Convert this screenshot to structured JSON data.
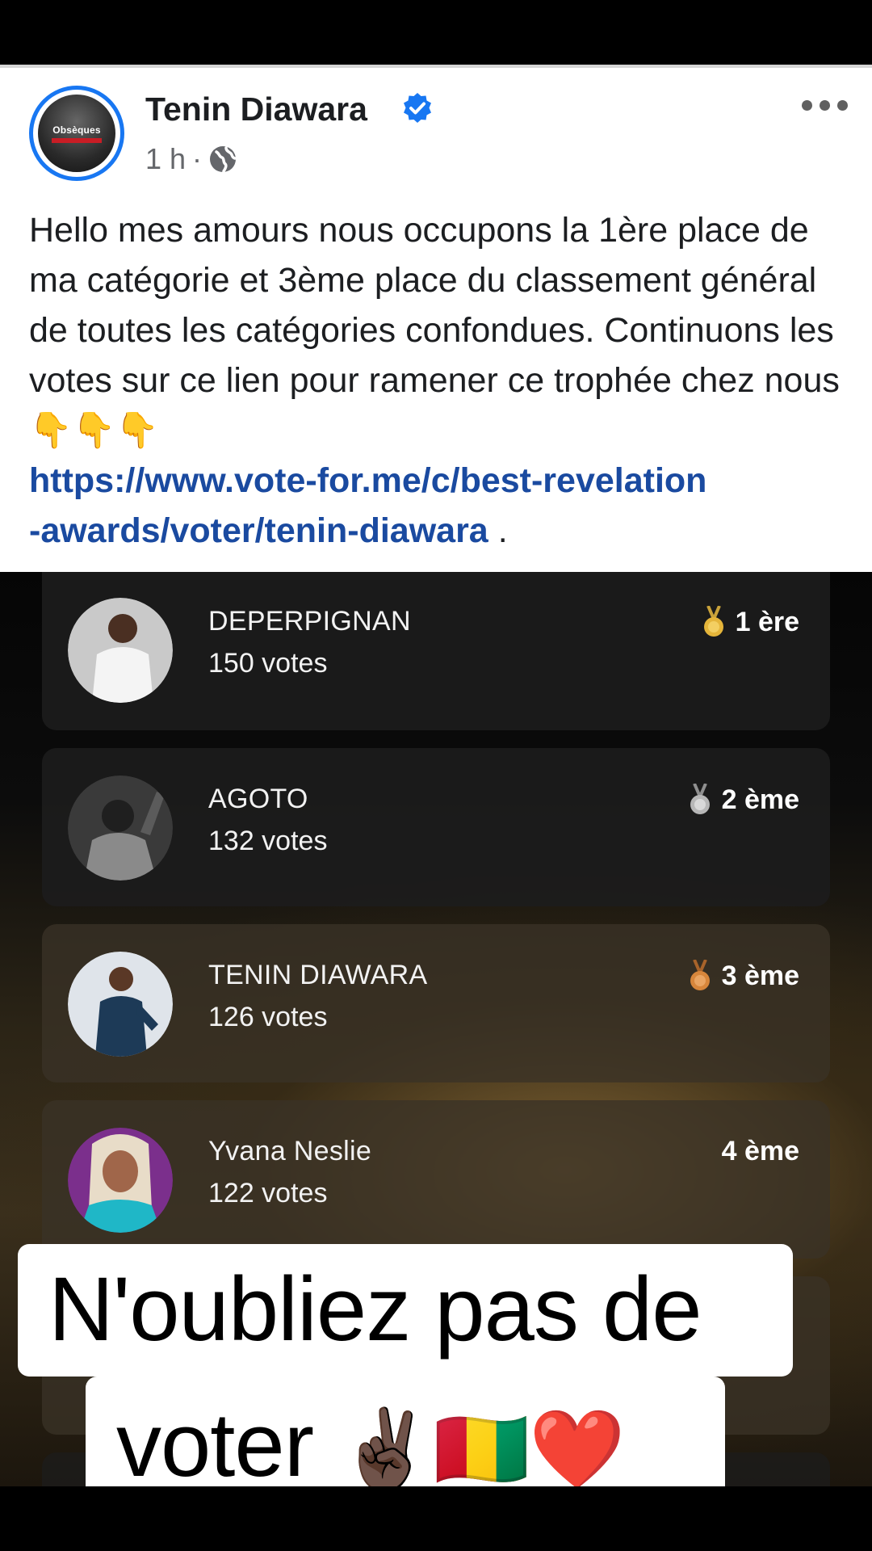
{
  "post": {
    "author": "Tenin Diawara",
    "avatar_label": "Obsèques",
    "time": "1 h",
    "separator": "·",
    "body": "Hello mes amours nous occupons la 1ère place de ma catégorie et 3ème place du classement général de toutes les catégories confondues. Continuons les votes sur ce lien pour ramener ce trophée chez nous",
    "emojis": "👇👇👇",
    "link": "https://www.vote-for.me/c/best-revelation-awards/voter/tenin-diawara",
    "link_line1": "https://www.vote-for.me/c/best-revelation",
    "link_line2": "-awards/voter/tenin-diawara",
    "link_end": "."
  },
  "ranking": [
    {
      "name": "DEPERPIGNAN",
      "votes": "150 votes",
      "rank": "1 ère",
      "medal": "gold-medal",
      "medal_color": "#e5b53a"
    },
    {
      "name": "AGOTO",
      "votes": "132 votes",
      "rank": "2 ème",
      "medal": "silver-medal",
      "medal_color": "#b7b7b7"
    },
    {
      "name": "TENIN DIAWARA",
      "votes": "126 votes",
      "rank": "3 ème",
      "medal": "bronze-medal",
      "medal_color": "#d7863b"
    },
    {
      "name": "Yvana Neslie",
      "votes": "122 votes",
      "rank": "4 ème",
      "medal": "",
      "medal_color": ""
    }
  ],
  "caption": {
    "line1": "N'oubliez pas de",
    "line2": "voter",
    "emojis": "✌🏿🇬🇳❤️"
  },
  "colors": {
    "accent": "#1877f2",
    "link": "#1a4aa0"
  }
}
